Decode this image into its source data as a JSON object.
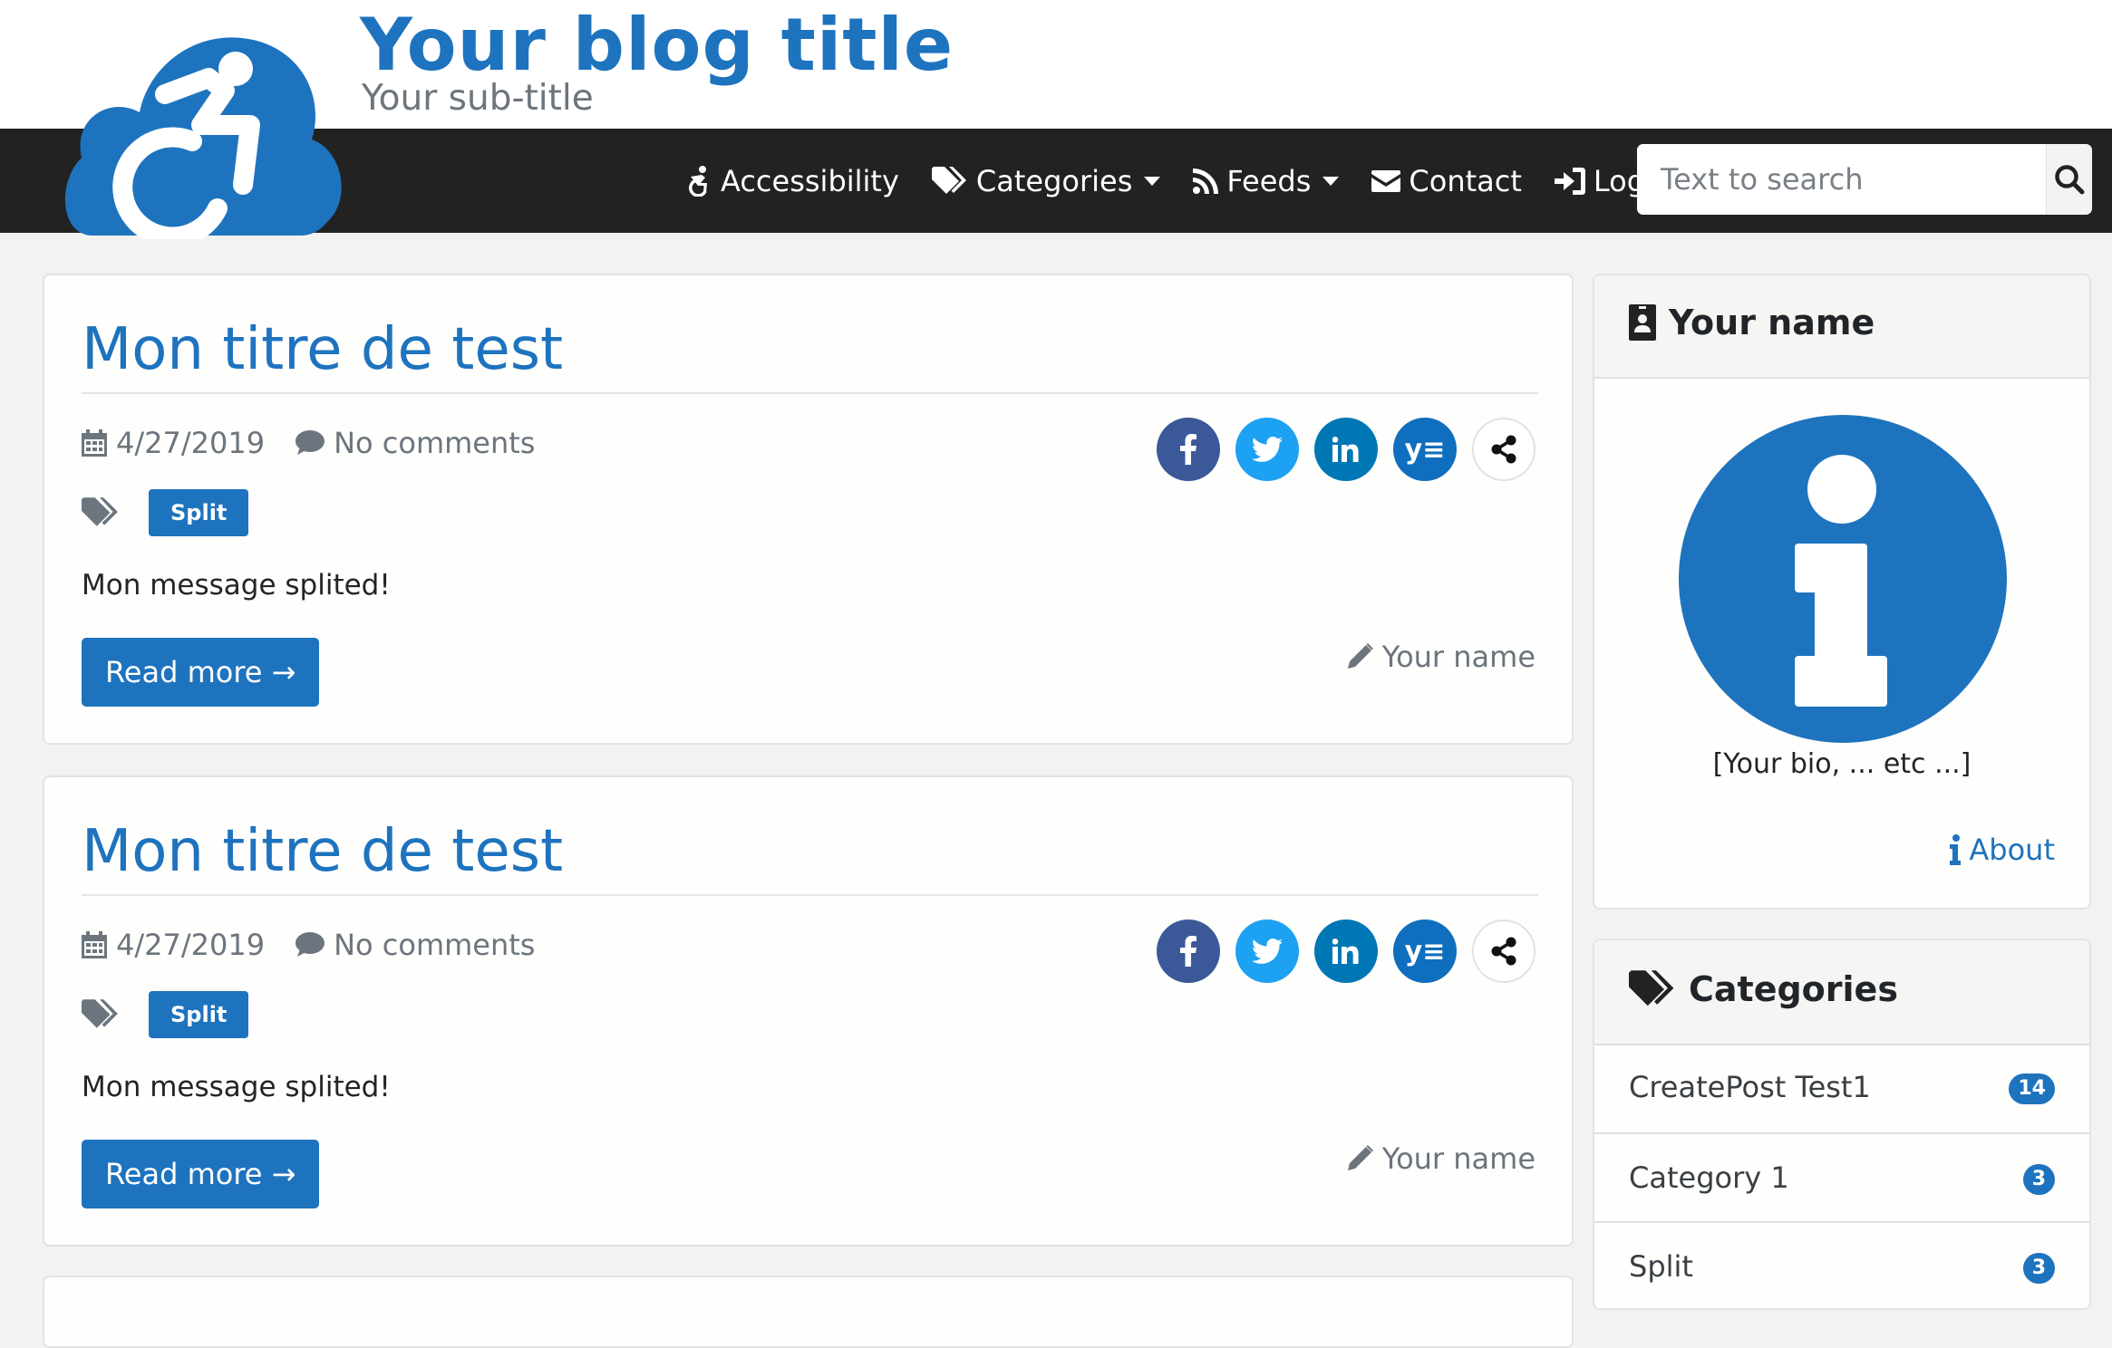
{
  "header": {
    "title": "Your blog title",
    "subtitle": "Your sub-title",
    "logo_icon": "wheelchair-cloud-icon",
    "brand_color": "#1e73be"
  },
  "nav": {
    "accessibility": "Accessibility",
    "categories": "Categories",
    "feeds": "Feeds",
    "contact": "Contact",
    "login": "Login in"
  },
  "search": {
    "placeholder": "Text to search",
    "value": ""
  },
  "posts": [
    {
      "title": "Mon titre de test",
      "date": "4/27/2019",
      "comments": "No comments",
      "tag": "Split",
      "excerpt": "Mon message splited!",
      "read_more": "Read more →",
      "author": "Your name"
    },
    {
      "title": "Mon titre de test",
      "date": "4/27/2019",
      "comments": "No comments",
      "tag": "Split",
      "excerpt": "Mon message splited!",
      "read_more": "Read more →",
      "author": "Your name"
    }
  ],
  "share": {
    "facebook_color": "#3b5998",
    "twitter_color": "#1da1f2",
    "linkedin_color": "#0077b5",
    "yammer_color": "#106ebe",
    "yammer_label": "y≡"
  },
  "profile": {
    "title": "Your name",
    "bio": "[Your bio, ... etc ...]",
    "about": "About",
    "avatar_icon": "info-circle-icon"
  },
  "categories": {
    "title": "Categories",
    "items": [
      {
        "label": "CreatePost Test1",
        "count": "14"
      },
      {
        "label": "Category 1",
        "count": "3"
      },
      {
        "label": "Split",
        "count": "3"
      }
    ]
  }
}
